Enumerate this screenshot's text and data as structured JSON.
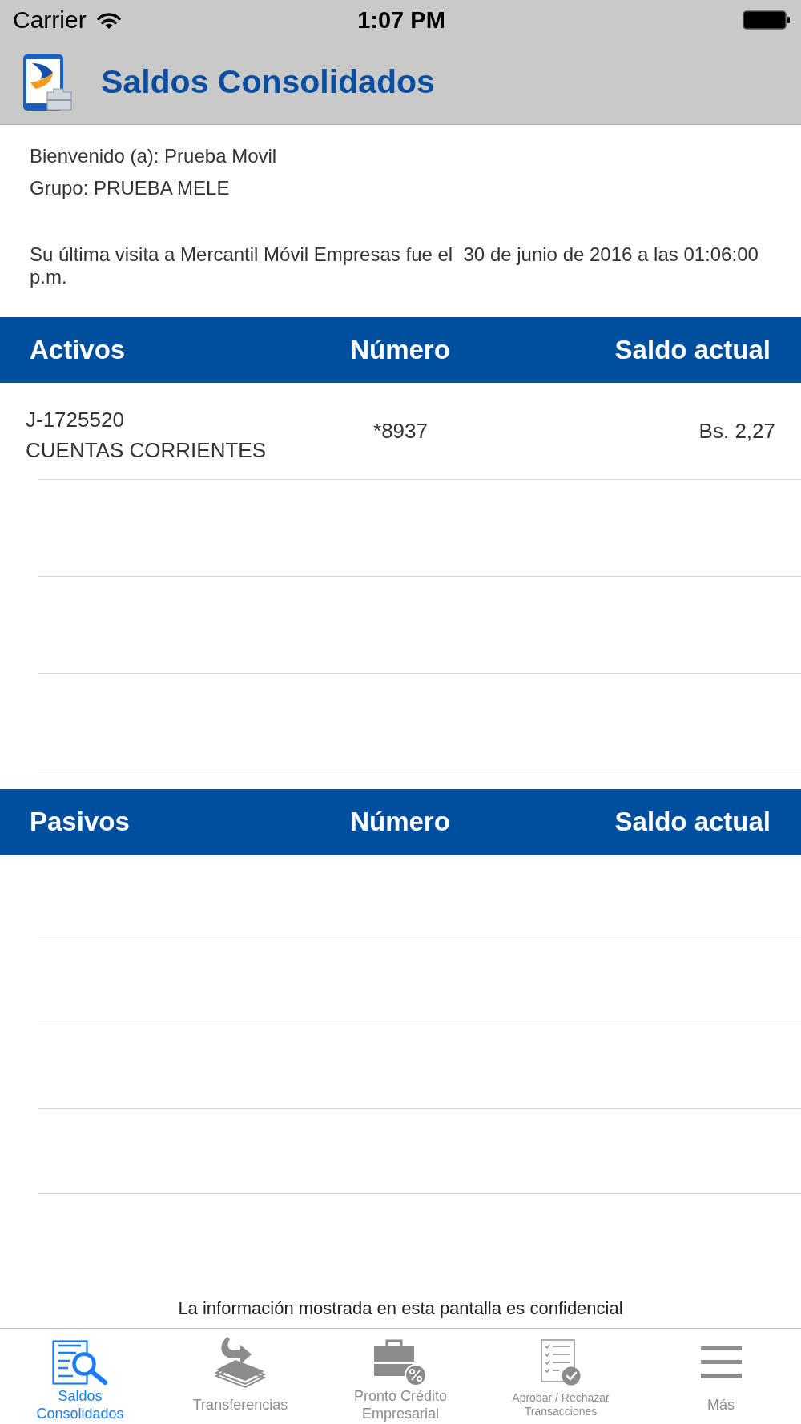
{
  "status_bar": {
    "carrier": "Carrier",
    "time": "1:07 PM"
  },
  "header": {
    "title": "Saldos Consolidados"
  },
  "welcome": {
    "greeting": "Bienvenido (a): Prueba Movil",
    "group": "Grupo: PRUEBA MELE",
    "last_visit": "Su última visita a Mercantil Móvil Empresas fue el  30 de junio de 2016 a las 01:06:00 p.m."
  },
  "sections": [
    {
      "columns": [
        "Activos",
        "Número",
        "Saldo actual"
      ],
      "rows": [
        {
          "code": "J-1725520",
          "type": "CUENTAS CORRIENTES",
          "number": "*8937",
          "balance": "Bs. 2,27"
        }
      ]
    },
    {
      "columns": [
        "Pasivos",
        "Número",
        "Saldo actual"
      ]
    }
  ],
  "footer_note": "La información mostrada en esta pantalla es confidencial",
  "tabs": [
    {
      "label": "Saldos Consolidados",
      "selected": true
    },
    {
      "label": "Transferencias",
      "selected": false
    },
    {
      "label": "Pronto Crédito Empresarial",
      "selected": false
    },
    {
      "label": "Aprobar / Rechazar Transacciones",
      "selected": false
    },
    {
      "label": "Más",
      "selected": false
    }
  ]
}
